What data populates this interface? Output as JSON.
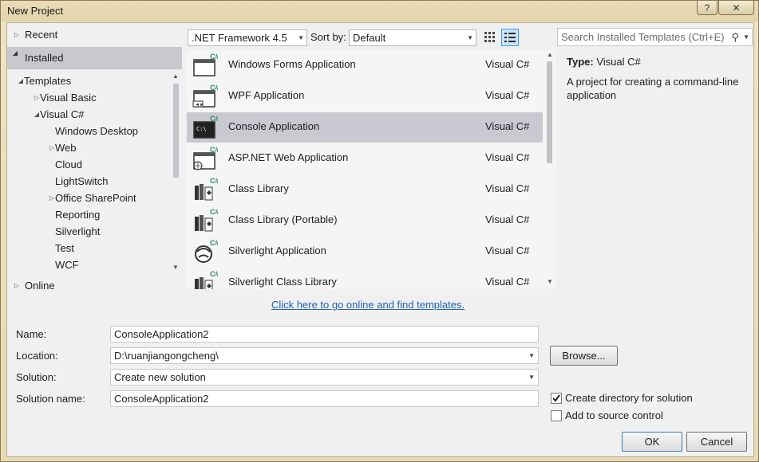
{
  "window": {
    "title": "New Project",
    "help_icon": "?",
    "close_icon": "✕"
  },
  "left": {
    "recent": "Recent",
    "installed": "Installed",
    "online": "Online",
    "tree": [
      {
        "label": "Templates",
        "indent": 0,
        "arrow": "expanded"
      },
      {
        "label": "Visual Basic",
        "indent": 1,
        "arrow": "collapsed"
      },
      {
        "label": "Visual C#",
        "indent": 1,
        "arrow": "expanded"
      },
      {
        "label": "Windows Desktop",
        "indent": 2,
        "arrow": "none"
      },
      {
        "label": "Web",
        "indent": 2,
        "arrow": "collapsed"
      },
      {
        "label": "Cloud",
        "indent": 2,
        "arrow": "none"
      },
      {
        "label": "LightSwitch",
        "indent": 2,
        "arrow": "none"
      },
      {
        "label": "Office SharePoint",
        "indent": 2,
        "arrow": "collapsed"
      },
      {
        "label": "Reporting",
        "indent": 2,
        "arrow": "none"
      },
      {
        "label": "Silverlight",
        "indent": 2,
        "arrow": "none"
      },
      {
        "label": "Test",
        "indent": 2,
        "arrow": "none"
      },
      {
        "label": "WCF",
        "indent": 2,
        "arrow": "none"
      }
    ]
  },
  "toolbar": {
    "framework": ".NET Framework 4.5",
    "sort_label": "Sort by:",
    "sort_value": "Default",
    "search_placeholder": "Search Installed Templates (Ctrl+E)"
  },
  "templates": [
    {
      "name": "Windows Forms Application",
      "lang": "Visual C#",
      "icon": "winforms-icon",
      "selected": false
    },
    {
      "name": "WPF Application",
      "lang": "Visual C#",
      "icon": "wpf-icon",
      "selected": false
    },
    {
      "name": "Console Application",
      "lang": "Visual C#",
      "icon": "console-icon",
      "selected": true
    },
    {
      "name": "ASP.NET Web Application",
      "lang": "Visual C#",
      "icon": "web-icon",
      "selected": false
    },
    {
      "name": "Class Library",
      "lang": "Visual C#",
      "icon": "class-library-icon",
      "selected": false
    },
    {
      "name": "Class Library (Portable)",
      "lang": "Visual C#",
      "icon": "class-library-portable-icon",
      "selected": false
    },
    {
      "name": "Silverlight Application",
      "lang": "Visual C#",
      "icon": "silverlight-icon",
      "selected": false
    },
    {
      "name": "Silverlight Class Library",
      "lang": "Visual C#",
      "icon": "silverlight-class-library-icon",
      "selected": false
    }
  ],
  "info": {
    "type_label": "Type:",
    "type_value": "Visual C#",
    "description": "A project for creating a command-line application"
  },
  "online_link": "Click here to go online and find templates.",
  "form": {
    "name_label": "Name:",
    "name_value": "ConsoleApplication2",
    "location_label": "Location:",
    "location_value": "D:\\ruanjiangongcheng\\",
    "solution_label": "Solution:",
    "solution_value": "Create new solution",
    "solution_name_label": "Solution name:",
    "solution_name_value": "ConsoleApplication2",
    "browse": "Browse...",
    "create_dir_label": "Create directory for solution",
    "create_dir_checked": true,
    "source_control_label": "Add to source control",
    "source_control_checked": false,
    "ok": "OK",
    "cancel": "Cancel"
  },
  "colors": {
    "link": "#1e60b2",
    "selection": "#c9c9d1",
    "csharp_badge": "#2e8b57"
  }
}
